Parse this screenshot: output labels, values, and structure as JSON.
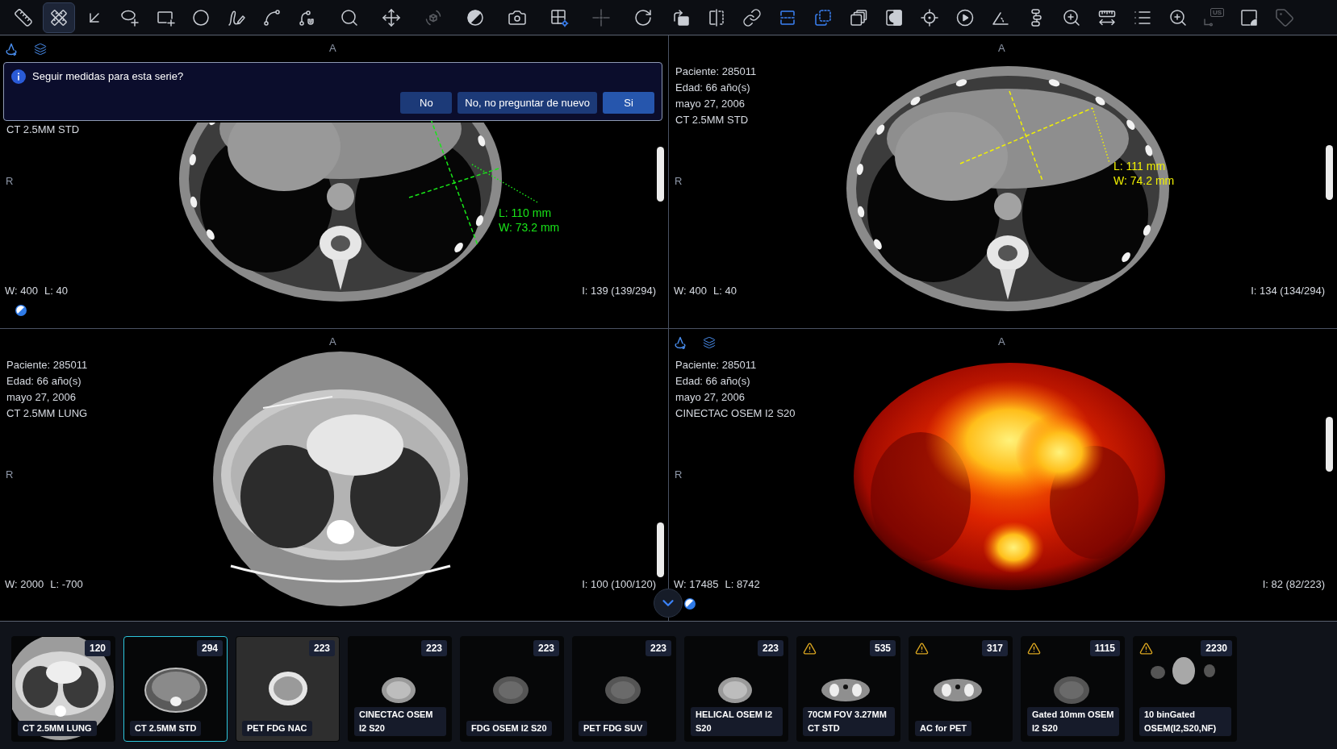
{
  "toolbar": {
    "tools": [
      {
        "kind": "ruler",
        "selected": false,
        "on": false,
        "disabled": false
      },
      {
        "kind": "crossed_rulers",
        "selected": true,
        "on": false,
        "disabled": false
      },
      {
        "kind": "arrow",
        "selected": false,
        "on": false,
        "disabled": false
      },
      {
        "kind": "ellipse_add",
        "selected": false,
        "on": false,
        "disabled": false
      },
      {
        "kind": "rect_add",
        "selected": false,
        "on": false,
        "disabled": false
      },
      {
        "kind": "circle",
        "selected": false,
        "on": false,
        "disabled": false
      },
      {
        "kind": "freehand",
        "selected": false,
        "on": false,
        "disabled": false
      },
      {
        "kind": "spline",
        "selected": false,
        "on": false,
        "disabled": false
      },
      {
        "kind": "spline_magnet",
        "selected": false,
        "on": false,
        "disabled": false
      },
      {
        "kind": "search",
        "selected": false,
        "on": false,
        "disabled": false
      },
      {
        "kind": "move",
        "selected": false,
        "on": false,
        "disabled": false
      },
      {
        "kind": "rotate_3d",
        "selected": false,
        "on": false,
        "disabled": true
      },
      {
        "kind": "contrast",
        "selected": false,
        "on": false,
        "disabled": false
      },
      {
        "kind": "camera",
        "selected": false,
        "on": false,
        "disabled": false
      },
      {
        "kind": "grid_gear",
        "selected": false,
        "on": false,
        "disabled": false
      },
      {
        "kind": "crosshair",
        "selected": false,
        "on": false,
        "disabled": true
      },
      {
        "kind": "rotate_cw",
        "selected": false,
        "on": false,
        "disabled": false
      },
      {
        "kind": "rotate_image",
        "selected": false,
        "on": false,
        "disabled": false
      },
      {
        "kind": "flip",
        "selected": false,
        "on": false,
        "disabled": false
      },
      {
        "kind": "link",
        "selected": false,
        "on": false,
        "disabled": false
      },
      {
        "kind": "split_rows",
        "selected": false,
        "on": true,
        "disabled": false
      },
      {
        "kind": "dashed_copy",
        "selected": false,
        "on": true,
        "disabled": false
      },
      {
        "kind": "stack",
        "selected": false,
        "on": false,
        "disabled": false
      },
      {
        "kind": "invert",
        "selected": false,
        "on": false,
        "disabled": false
      },
      {
        "kind": "target",
        "selected": false,
        "on": false,
        "disabled": false
      },
      {
        "kind": "play",
        "selected": false,
        "on": false,
        "disabled": false
      },
      {
        "kind": "angle",
        "selected": false,
        "on": false,
        "disabled": false
      },
      {
        "kind": "spine",
        "selected": false,
        "on": false,
        "disabled": false
      },
      {
        "kind": "zoom_in",
        "selected": false,
        "on": false,
        "disabled": false
      },
      {
        "kind": "ruler_arrows",
        "selected": false,
        "on": false,
        "disabled": false
      },
      {
        "kind": "list",
        "selected": false,
        "on": false,
        "disabled": false
      },
      {
        "kind": "zoom_in",
        "selected": false,
        "on": false,
        "disabled": false
      },
      {
        "kind": "us_tag",
        "label": "US",
        "selected": false,
        "on": false,
        "disabled": true
      },
      {
        "kind": "rect_corner",
        "selected": false,
        "on": false,
        "disabled": false
      },
      {
        "kind": "tag",
        "selected": false,
        "on": false,
        "disabled": true
      }
    ]
  },
  "viewports": [
    {
      "kind": "ct_soft",
      "tool_icons": true,
      "orientation_top": "A",
      "orientation_left": "R",
      "dialog": {
        "message": "Seguir medidas para esta serie?",
        "buttons": [
          {
            "label": "No",
            "kind": "secondary"
          },
          {
            "label": "No, no preguntar de nuevo",
            "kind": "secondary"
          },
          {
            "label": "Si",
            "kind": "primary"
          }
        ]
      },
      "info": [
        "CT 2.5MM STD"
      ],
      "measurement": {
        "length": "L: 110 mm",
        "width": "W: 73.2 mm",
        "color": "#19e619"
      },
      "window_width": "W: 400",
      "window_level": "L: 40",
      "image_index": "I: 139 (139/294)",
      "contrast_icon": true
    },
    {
      "kind": "ct_soft",
      "tool_icons": false,
      "orientation_top": "A",
      "orientation_left": "R",
      "info": [
        "Paciente: 285011",
        "Edad: 66 año(s)",
        "mayo 27, 2006",
        "CT 2.5MM STD"
      ],
      "measurement": {
        "length": "L: 111 mm",
        "width": "W: 74.2 mm",
        "color": "#f2f200"
      },
      "window_width": "W: 400",
      "window_level": "L: 40",
      "image_index": "I: 134 (134/294)",
      "contrast_icon": false
    },
    {
      "kind": "ct_lung",
      "tool_icons": false,
      "orientation_top": "A",
      "orientation_left": "R",
      "info": [
        "Paciente: 285011",
        "Edad: 66 año(s)",
        "mayo 27, 2006",
        "CT 2.5MM LUNG"
      ],
      "window_width": "W: 2000",
      "window_level": "L: -700",
      "image_index": "I: 100 (100/120)",
      "contrast_icon": false
    },
    {
      "kind": "pet",
      "tool_icons": true,
      "orientation_top": "A",
      "orientation_left": "R",
      "info": [
        "Paciente: 285011",
        "Edad: 66 año(s)",
        "mayo 27, 2006",
        "CINECTAC OSEM I2 S20"
      ],
      "window_width": "W: 17485",
      "window_level": "L: 8742",
      "image_index": "I: 82 (82/223)",
      "contrast_icon": true
    }
  ],
  "series": [
    {
      "label": "CT 2.5MM LUNG",
      "count": "120",
      "selected": false,
      "warning": false,
      "kind": "ct_lung"
    },
    {
      "label": "CT 2.5MM STD",
      "count": "294",
      "selected": true,
      "warning": false,
      "kind": "ct_abdomen"
    },
    {
      "label": "PET FDG NAC",
      "count": "223",
      "selected": false,
      "warning": false,
      "kind": "pet_nac"
    },
    {
      "label": "CINECTAC OSEM I2 S20",
      "count": "223",
      "selected": false,
      "warning": false,
      "kind": "pet_blob"
    },
    {
      "label": "FDG OSEM I2 S20",
      "count": "223",
      "selected": false,
      "warning": false,
      "kind": "pet_faint"
    },
    {
      "label": "PET FDG SUV",
      "count": "223",
      "selected": false,
      "warning": false,
      "kind": "pet_faint"
    },
    {
      "label": "HELICAL OSEM I2 S20",
      "count": "223",
      "selected": false,
      "warning": false,
      "kind": "pet_blob"
    },
    {
      "label": "70CM FOV 3.27MM CT STD",
      "count": "535",
      "selected": false,
      "warning": true,
      "kind": "ct_pelvis"
    },
    {
      "label": "AC for PET",
      "count": "317",
      "selected": false,
      "warning": true,
      "kind": "ct_pelvis"
    },
    {
      "label": "Gated 10mm OSEM I2 S20",
      "count": "1115",
      "selected": false,
      "warning": true,
      "kind": "pet_faint"
    },
    {
      "label": "10 binGated OSEM(I2,S20,NF)",
      "count": "2230",
      "selected": false,
      "warning": true,
      "kind": "pet_gated"
    }
  ]
}
